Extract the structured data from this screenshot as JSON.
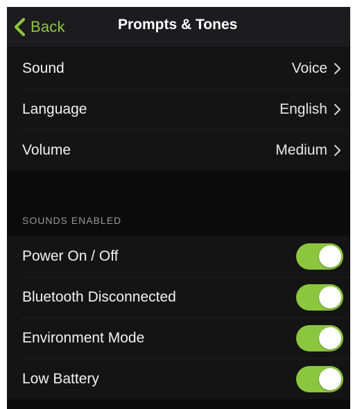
{
  "theme": {
    "accent": "#8cc63f",
    "background": "#0b0b0b",
    "navbar_background": "#1c1c1e"
  },
  "navbar": {
    "back_label": "Back",
    "back_icon": "chevron-left-icon",
    "title": "Prompts & Tones"
  },
  "settings": [
    {
      "label": "Sound",
      "value": "Voice",
      "icon": "chevron-right-icon"
    },
    {
      "label": "Language",
      "value": "English",
      "icon": "chevron-right-icon"
    },
    {
      "label": "Volume",
      "value": "Medium",
      "icon": "chevron-right-icon"
    }
  ],
  "sounds_enabled": {
    "header": "SOUNDS ENABLED",
    "items": [
      {
        "label": "Power On / Off",
        "enabled": true
      },
      {
        "label": "Bluetooth Disconnected",
        "enabled": true
      },
      {
        "label": "Environment Mode",
        "enabled": true
      },
      {
        "label": "Low Battery",
        "enabled": true
      }
    ]
  }
}
